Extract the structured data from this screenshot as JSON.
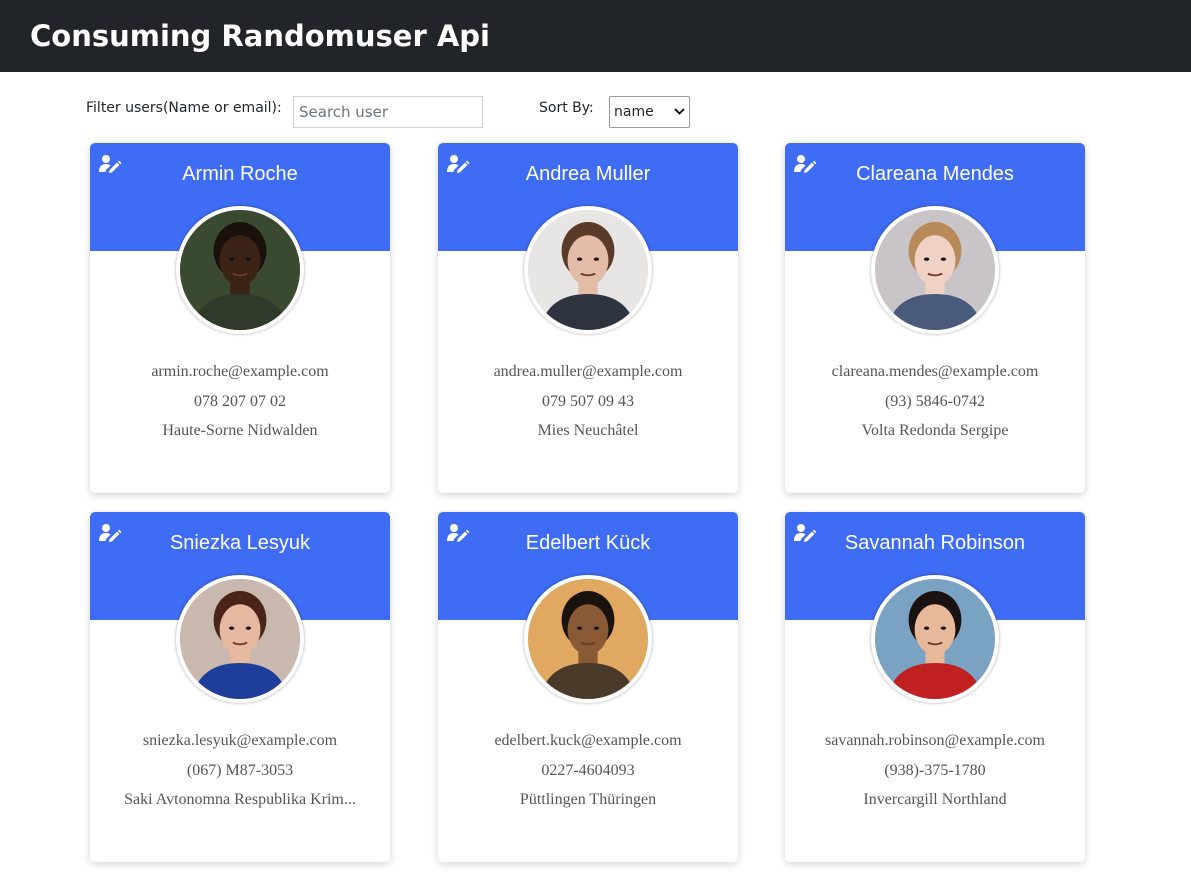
{
  "header": {
    "title": "Consuming Randomuser Api"
  },
  "filter": {
    "label": "Filter users(Name or email):",
    "placeholder": "Search user",
    "value": ""
  },
  "sort": {
    "label": "Sort By:",
    "selected": "name"
  },
  "colors": {
    "header_bg": "#212529",
    "card_band": "#3f6cf5"
  },
  "users": [
    {
      "name": "Armin Roche",
      "email": "armin.roche@example.com",
      "phone": "078 207 07 02",
      "location": "Haute-Sorne Nidwalden",
      "icon": "edit-user-icon"
    },
    {
      "name": "Andrea Muller",
      "email": "andrea.muller@example.com",
      "phone": "079 507 09 43",
      "location": "Mies Neuchâtel",
      "icon": "edit-user-icon"
    },
    {
      "name": "Clareana Mendes",
      "email": "clareana.mendes@example.com",
      "phone": "(93) 5846-0742",
      "location": "Volta Redonda Sergipe",
      "icon": "edit-user-icon"
    },
    {
      "name": "Sniezka Lesyuk",
      "email": "sniezka.lesyuk@example.com",
      "phone": "(067) M87-3053",
      "location": "Saki Avtonomna Respublika Krim...",
      "icon": "edit-user-icon"
    },
    {
      "name": "Edelbert Kück",
      "email": "edelbert.kuck@example.com",
      "phone": "0227-4604093",
      "location": "Püttlingen Thüringen",
      "icon": "edit-user-icon"
    },
    {
      "name": "Savannah Robinson",
      "email": "savannah.robinson@example.com",
      "phone": "(938)-375-1780",
      "location": "Invercargill Northland",
      "icon": "edit-user-icon"
    }
  ]
}
